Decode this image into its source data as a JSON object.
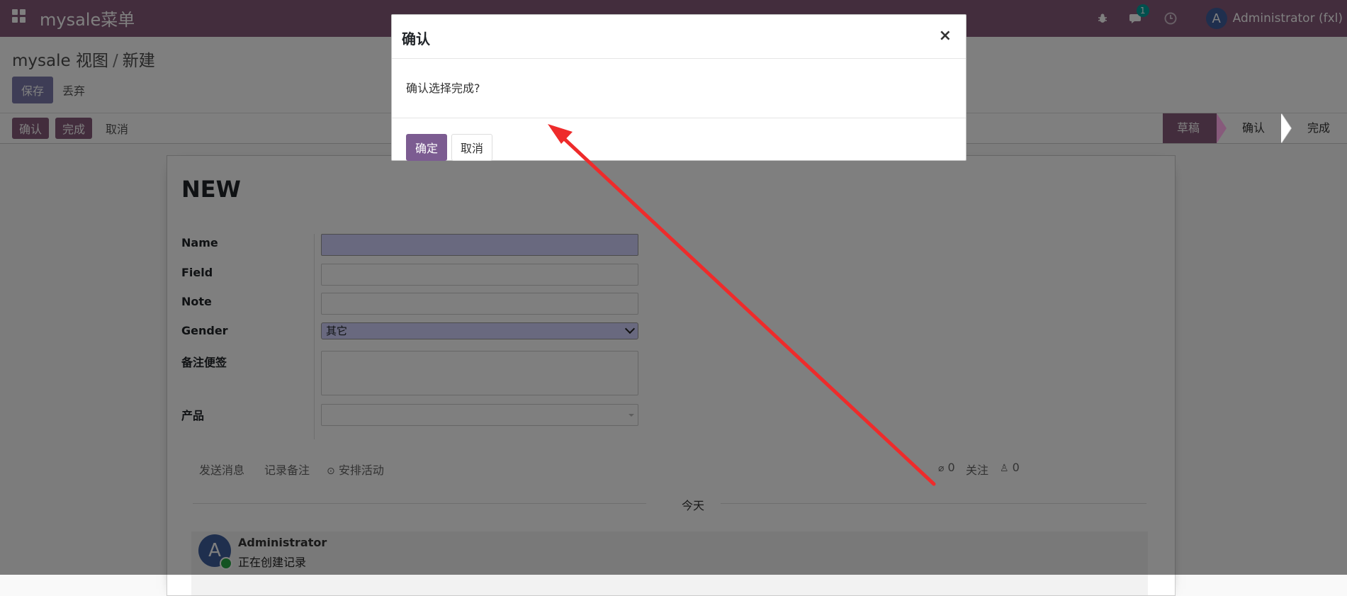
{
  "navbar": {
    "brand": "mysale菜单",
    "chat_badge": "1",
    "user_initial": "A",
    "user_name": "Administrator (fxl)",
    "icons": [
      "apps-grid-icon",
      "bug-icon",
      "chat-icon",
      "clock-icon"
    ]
  },
  "control_panel": {
    "breadcrumb_parent": "mysale 视图",
    "breadcrumb_sep": "/",
    "breadcrumb_current": "新建",
    "save_label": "保存",
    "discard_label": "丢弃"
  },
  "statusbar": {
    "confirm_label": "确认",
    "done_label": "完成",
    "cancel_label": "取消",
    "steps": [
      "草稿",
      "确认",
      "完成"
    ]
  },
  "form": {
    "title": "NEW",
    "labels": {
      "name": "Name",
      "field": "Field",
      "note": "Note",
      "gender": "Gender",
      "memo": "备注便签",
      "product": "产品"
    },
    "gender_value": "其它"
  },
  "chatter": {
    "send_message": "发送消息",
    "log_note": "记录备注",
    "schedule_activity": "安排活动",
    "attachments_count": "0",
    "follow_label": "关注",
    "followers_count": "0",
    "today_label": "今天",
    "message_author": "Administrator",
    "message_body": "正在创建记录",
    "message_initial": "A"
  },
  "dialog": {
    "title": "确认",
    "close_symbol": "×",
    "message": "确认选择完成?",
    "ok_label": "确定",
    "cancel_label": "取消"
  },
  "colors": {
    "brand": "#875a7b",
    "primary_button": "#7c5c91",
    "annotation_arrow": "#ee2b2b",
    "required_field": "#d2d2ff"
  }
}
